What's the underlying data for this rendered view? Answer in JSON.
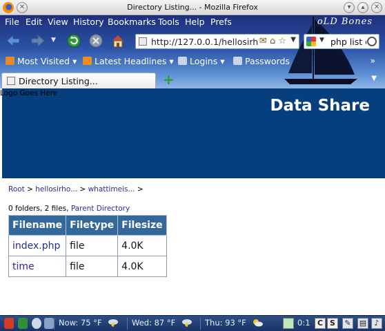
{
  "window": {
    "title": "Directory Listing... - Mozilla Firefox"
  },
  "menu": {
    "items": [
      "File",
      "Edit",
      "View",
      "History",
      "Bookmarks",
      "Tools",
      "Help",
      "Prefs"
    ]
  },
  "theme": {
    "name": "oLD Bones"
  },
  "navigation": {
    "url": "http://127.0.0.1/hellosirh",
    "search_text": "php list d"
  },
  "bookmarks": {
    "items": [
      "Most Visited",
      "Latest Headlines",
      "Logins",
      "Passwords"
    ]
  },
  "tabs": [
    {
      "title": "Directory Listing..."
    }
  ],
  "page": {
    "logo_text": "Logo Goes Here",
    "site_title": "Data Share",
    "breadcrumb": {
      "root": "Root",
      "sep": " > ",
      "crumbs": [
        "hellosirho...",
        "whattimeis..."
      ],
      "trail_end": " >"
    },
    "summary": {
      "text": "0 folders, 2 files, ",
      "parent_link": "Parent Directory"
    },
    "table": {
      "headers": [
        "Filename",
        "Filetype",
        "Filesize"
      ],
      "rows": [
        {
          "name": "index.php",
          "type": "file",
          "size": "4.0K"
        },
        {
          "name": "time",
          "type": "file",
          "size": "4.0K"
        }
      ]
    },
    "colors": {
      "header_bg": "#063e7e",
      "table_header_bg": "#34689b",
      "link": "#2a2a9a"
    }
  },
  "taskbar": {
    "weather": [
      {
        "label": "Now: 75 °F",
        "icon": "thunderstorm-icon"
      },
      {
        "label": "Wed: 87 °F",
        "icon": "thunderstorm-icon"
      },
      {
        "label": "Thu: 93 °F",
        "icon": "partly-sunny-icon"
      }
    ],
    "indicator": "0:1"
  }
}
